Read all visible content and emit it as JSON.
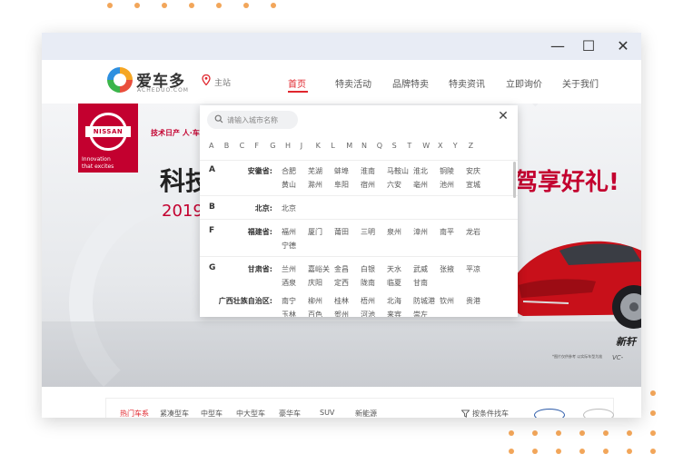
{
  "window": {
    "minimize_glyph": "—",
    "maximize_glyph": "☐",
    "close_glyph": "✕"
  },
  "brand": {
    "name": "爱车多",
    "domain": "ACHEDUO.COM"
  },
  "location": {
    "label": "主站"
  },
  "nav": [
    {
      "label": "首页",
      "active": true
    },
    {
      "label": "特卖活动",
      "active": false
    },
    {
      "label": "品牌特卖",
      "active": false
    },
    {
      "label": "特卖资讯",
      "active": false
    },
    {
      "label": "立即询价",
      "active": false
    },
    {
      "label": "关于我们",
      "active": false
    }
  ],
  "banner": {
    "nissan_name": "NISSAN",
    "nissan_slogan_1": "Innovation",
    "nissan_slogan_2": "that excites",
    "tagline": "技术日产 人·车",
    "headline_left": "科技",
    "year_left": "2019",
    "headline_right": "驾享好礼!",
    "badge_model": "新轩",
    "badge_sub": "VC-",
    "fine_print": "*图片仅供参考 以实际车型为准"
  },
  "city_picker": {
    "search_placeholder": "请输入城市名称",
    "close_glyph": "✕",
    "letters": [
      "A",
      "B",
      "C",
      "F",
      "G",
      "H",
      "J",
      "K",
      "L",
      "M",
      "N",
      "Q",
      "S",
      "T",
      "W",
      "X",
      "Y",
      "Z"
    ],
    "groups": [
      {
        "letter": "A",
        "provinces": [
          {
            "name": "安徽省:",
            "cities": [
              "合肥",
              "芜湖",
              "蚌埠",
              "淮南",
              "马鞍山",
              "淮北",
              "铜陵",
              "安庆",
              "黄山",
              "滁州",
              "阜阳",
              "宿州",
              "六安",
              "亳州",
              "池州",
              "宣城"
            ]
          }
        ]
      },
      {
        "letter": "B",
        "provinces": [
          {
            "name": "北京:",
            "cities": [
              "北京"
            ]
          }
        ]
      },
      {
        "letter": "F",
        "provinces": [
          {
            "name": "福建省:",
            "cities": [
              "福州",
              "厦门",
              "莆田",
              "三明",
              "泉州",
              "漳州",
              "南平",
              "龙岩",
              "宁德"
            ]
          }
        ]
      },
      {
        "letter": "G",
        "provinces": [
          {
            "name": "甘肃省:",
            "cities": [
              "兰州",
              "嘉峪关",
              "金昌",
              "白银",
              "天水",
              "武威",
              "张掖",
              "平凉",
              "酒泉",
              "庆阳",
              "定西",
              "陇南",
              "临夏",
              "甘南"
            ]
          },
          {
            "name": "广西壮族自治区:",
            "cities": [
              "南宁",
              "柳州",
              "桂林",
              "梧州",
              "北海",
              "防城港",
              "钦州",
              "贵港",
              "玉林",
              "百色",
              "贺州",
              "河池",
              "来宾",
              "崇左"
            ]
          }
        ]
      }
    ]
  },
  "categories": {
    "items": [
      "热门车系",
      "紧凑型车",
      "中型车",
      "中大型车",
      "豪华车",
      "SUV",
      "新能源"
    ],
    "active_index": 0,
    "filter_label": "按条件找车"
  },
  "colors": {
    "accent": "#e0262d",
    "nissan_red": "#c3002f",
    "dot_orange": "#f2a65a",
    "titlebar": "#e8ecf5"
  }
}
